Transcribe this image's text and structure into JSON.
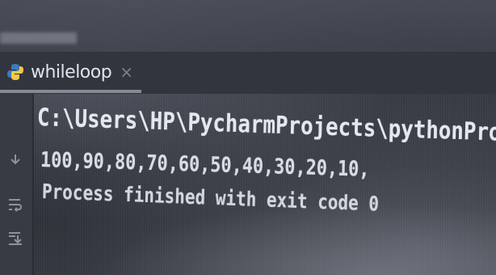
{
  "editor": {
    "tab": {
      "label": "whileloop",
      "close_glyph": "×",
      "icon": "python-file-icon"
    }
  },
  "run_console": {
    "lines": [
      "C:\\Users\\HP\\PycharmProjects\\pythonProje",
      "100,90,80,70,60,50,40,30,20,10,",
      "Process finished with exit code 0"
    ],
    "gutter_icons": [
      "arrow-down-icon",
      "soft-wrap-icon",
      "scroll-to-end-icon"
    ]
  },
  "colors": {
    "background": "#2b2e35",
    "text": "#e4e7ee",
    "python_blue": "#3d7ab8",
    "python_yellow": "#f2c84b"
  }
}
